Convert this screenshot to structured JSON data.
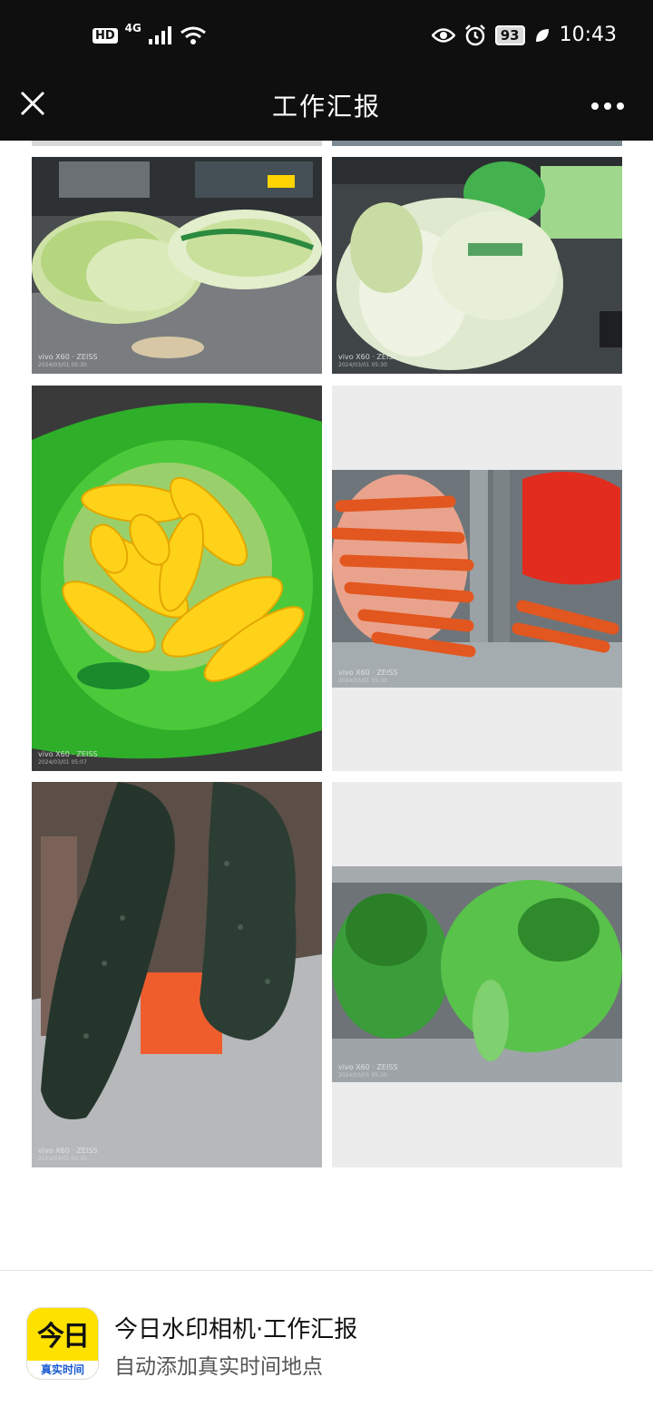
{
  "status_bar": {
    "hd": "HD",
    "network": "4G",
    "battery": "93",
    "time": "10:43"
  },
  "nav": {
    "title": "工作汇报",
    "close_icon": "close-icon",
    "more_icon": "more-icon"
  },
  "photos": [
    {
      "subject": "napa cabbage",
      "watermark": "vivo X60 · ZEISS",
      "date": "2024/03/01 05:30"
    },
    {
      "subject": "napa cabbage",
      "watermark": "vivo X60 · ZEISS",
      "date": "2024/03/01 05:30"
    },
    {
      "subject": "corn",
      "watermark": "vivo X60 · ZEISS",
      "date": "2024/03/01 05:07"
    },
    {
      "subject": "carrots",
      "watermark": "vivo X60 · ZEISS",
      "date": "2024/03/01 05:30"
    },
    {
      "subject": "winter melon",
      "watermark": "vivo X60 · ZEISS",
      "date": "2024/03/01 05:30"
    },
    {
      "subject": "leafy greens",
      "watermark": "vivo X60 · ZEISS",
      "date": "2024/03/01 05:30"
    }
  ],
  "footer": {
    "app_icon_text": "今日",
    "app_icon_strip": "真实时间",
    "title": "今日水印相机·工作汇报",
    "subtitle": "自动添加真实时间地点"
  },
  "colors": {
    "bar_bg": "#0f0f0f",
    "icon_yellow": "#ffe100",
    "icon_blue": "#1b5bd1"
  }
}
